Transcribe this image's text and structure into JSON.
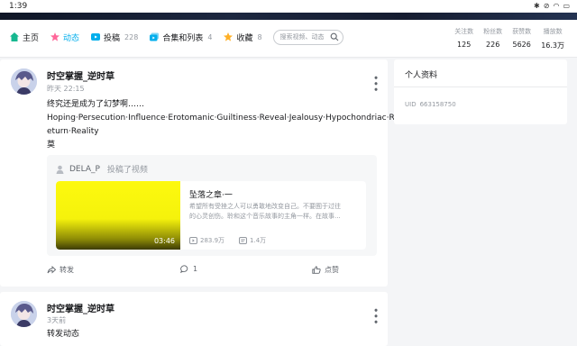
{
  "status_bar": {
    "time": "1:39",
    "icons": [
      "bluetooth-icon",
      "do-not-disturb-icon",
      "wifi-icon",
      "battery-icon"
    ]
  },
  "nav": {
    "tabs": [
      {
        "label": "主页",
        "count": "",
        "icon": "home-icon",
        "active": false
      },
      {
        "label": "动态",
        "count": "",
        "icon": "dynamic-icon",
        "active": true
      },
      {
        "label": "投稿",
        "count": "228",
        "icon": "upload-icon",
        "active": false
      },
      {
        "label": "合集和列表",
        "count": "4",
        "icon": "collection-icon",
        "active": false
      },
      {
        "label": "收藏",
        "count": "8",
        "icon": "favorite-icon",
        "active": false
      }
    ],
    "search_placeholder": "搜索视频、动态"
  },
  "stats": [
    {
      "label": "关注数",
      "value": "125"
    },
    {
      "label": "粉丝数",
      "value": "226"
    },
    {
      "label": "获赞数",
      "value": "5626"
    },
    {
      "label": "播放数",
      "value": "16.3万"
    }
  ],
  "post1": {
    "username": "时空掌握_逆时草",
    "time": "昨天 22:15",
    "content_lines": [
      "终究还是成为了幻梦啊……",
      "Hoping·Persecution·Influence·Erotomanic·Guiltiness·Reveal·Jealousy·Hypochondriac·R",
      "eturn·Reality",
      "莫"
    ],
    "repost": {
      "uploader": "DELA_P",
      "action": "投稿了视频",
      "video": {
        "title": "坠落之章·一",
        "desc_lines": [
          "希望所有受挫之人可以勇敢地改变自己。不要囿于过往",
          "的心灵创伤。聆和这个音乐故事的主角一样。在故事..."
        ],
        "duration": "03:46",
        "plays": "283.9万",
        "danmaku": "1.4万"
      }
    },
    "actions": {
      "repost": "转发",
      "comment": "1",
      "like": "点赞"
    }
  },
  "post2": {
    "username": "时空掌握_逆时草",
    "time": "3天前",
    "content": "转发动态"
  },
  "profile": {
    "title": "个人资料",
    "uid_label": "UID",
    "uid": "663158750"
  },
  "colors": {
    "accent": "#00aeec",
    "home_icon": "#17b890",
    "dynamic_icon": "#ff6699",
    "upload_icon": "#00aeec",
    "collection_icon": "#00aeec",
    "favorite_icon": "#ffb027",
    "thumb": "#fdf90e"
  }
}
